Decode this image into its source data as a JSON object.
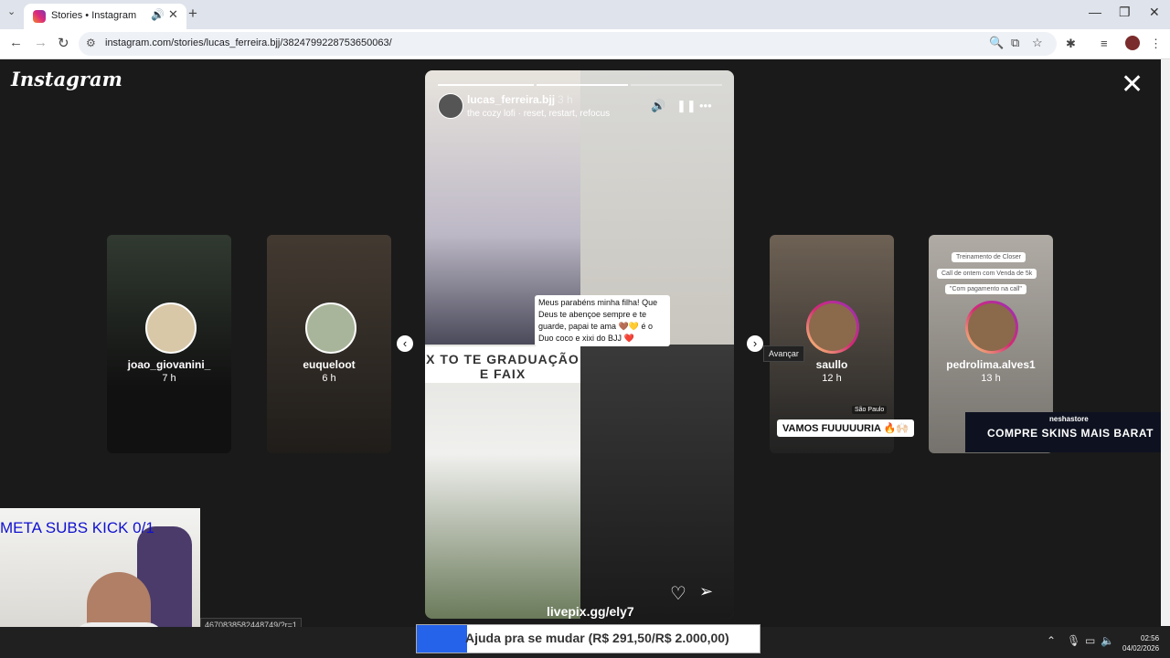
{
  "browser": {
    "tab_title": "Stories • Instagram",
    "url": "instagram.com/stories/lucas_ferreira.bjj/3824799228753650063/"
  },
  "page": {
    "logo": "Instagram",
    "close_label": "✕"
  },
  "story": {
    "username": "lucas_ferreira.bjj",
    "time": "3 h",
    "music": "the cozy lofi · reset, restart, refocus",
    "caption": "Meus parabéns minha filha! Que Deus te abençoe sempre e te guarde, papai te ama 🤎💛 é o Duo coco e xixi do BJJ ❤️",
    "banner_text": "X TO TE GRADUAÇÃO E FAIX",
    "overlay_link": "livepix.gg/ely7"
  },
  "thumbs": [
    {
      "username": "joao_giovanini_",
      "time": "7 h"
    },
    {
      "username": "euqueloot",
      "time": "6 h"
    },
    {
      "username": "saullo",
      "time": "12 h"
    },
    {
      "username": "pedrolima.alves1",
      "time": "13 h"
    }
  ],
  "saullo_sticker": "VAMOS FUUUUURIA 🔥🙌🏻",
  "saullo_location": "São Paulo",
  "pedro_chips": [
    "Treinamento de Closer",
    "Call de ontem com Venda de 5k",
    "\"Com pagamento na call\""
  ],
  "tooltip": "Avançar",
  "ad": {
    "brand": "neshastore",
    "tagline": "COMPRE SKINS MAIS BARAT"
  },
  "webcam": {
    "overlay": "META SUBS KICK 0/1"
  },
  "status_url": "4670838582448749/?r=1",
  "donation": {
    "text": "Ajuda pra se mudar (R$ 291,50/R$ 2.000,00)",
    "progress": 0.146
  },
  "clock": {
    "time": "02:56",
    "date": "04/02/2026"
  }
}
